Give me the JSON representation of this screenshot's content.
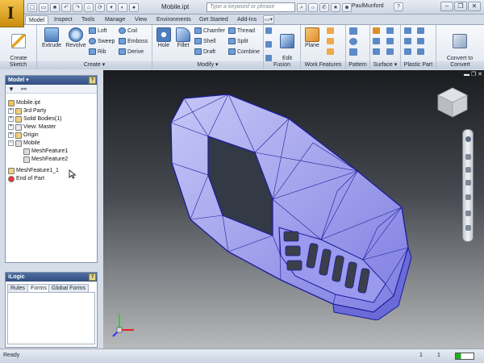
{
  "titlebar": {
    "document_title": "Mobile.ipt",
    "search_placeholder": "Type a keyword or phrase",
    "user": "PaulMunford"
  },
  "tabs": [
    {
      "label": "Model",
      "active": true
    },
    {
      "label": "Inspect"
    },
    {
      "label": "Tools"
    },
    {
      "label": "Manage"
    },
    {
      "label": "View"
    },
    {
      "label": "Environments"
    },
    {
      "label": "Get Started"
    },
    {
      "label": "Add-Ins"
    }
  ],
  "ribbon": {
    "sketch": {
      "label": "Sketch",
      "create_2d_sketch": "Create\n2D Sketch"
    },
    "create": {
      "label": "Create",
      "extrude": "Extrude",
      "revolve": "Revolve",
      "loft": "Loft",
      "sweep": "Sweep",
      "rib": "Rib",
      "coil": "Coil",
      "emboss": "Emboss",
      "derive": "Derive"
    },
    "modify": {
      "label": "Modify",
      "hole": "Hole",
      "fillet": "Fillet",
      "chamfer": "Chamfer",
      "shell": "Shell",
      "draft": "Draft",
      "thread": "Thread",
      "split": "Split",
      "combine": "Combine"
    },
    "fusion": {
      "label": "Fusion",
      "edit_form": "Edit\nForm"
    },
    "work_features": {
      "label": "Work Features",
      "plane": "Plane"
    },
    "pattern": {
      "label": "Pattern"
    },
    "surface": {
      "label": "Surface"
    },
    "plastic_part": {
      "label": "Plastic Part"
    },
    "convert": {
      "label": "Convert",
      "convert_to_sheet_metal": "Convert to\nSheet Metal"
    }
  },
  "model_pane": {
    "title": "Model",
    "tree": [
      {
        "label": "Mobile.ipt"
      },
      {
        "label": "3rd Party"
      },
      {
        "label": "Solid Bodies(1)"
      },
      {
        "label": "View: Master"
      },
      {
        "label": "Origin"
      },
      {
        "label": "Mobile"
      },
      {
        "label": "MeshFeature1"
      },
      {
        "label": "MeshFeature2"
      },
      {
        "label": "MeshFeature1_1"
      },
      {
        "label": "End of Part"
      }
    ]
  },
  "ilogic_pane": {
    "title": "iLogic",
    "tabs": [
      "Rules",
      "Forms",
      "Global Forms"
    ],
    "active_tab": "Forms"
  },
  "statusbar": {
    "status": "Ready",
    "count1": "1",
    "count2": "1"
  },
  "colors": {
    "mesh_fill": "#a9a9f0",
    "mesh_line": "#1a1aa0",
    "accent": "#f3c24a"
  }
}
